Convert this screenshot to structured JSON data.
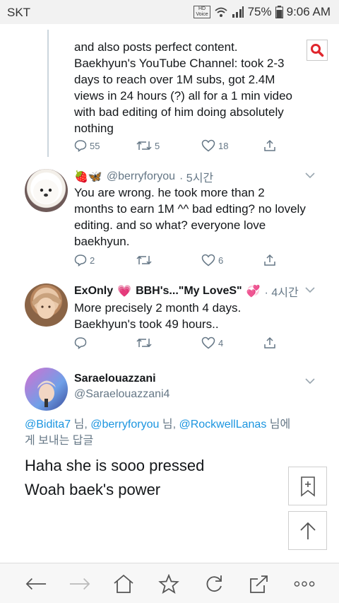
{
  "status_bar": {
    "carrier": "SKT",
    "hd_label": "HD",
    "voice_label": "Voice",
    "battery": "75%",
    "time": "9:06 AM"
  },
  "tweets": [
    {
      "lines": [
        "and also posts perfect content.",
        "Baekhyun's YouTube Channel: took 2-3",
        "days to reach over 1M subs, got 2.4M",
        "views in 24 hours (?) all for a 1 min video",
        "with bad editing of him doing absolutely",
        "nothing"
      ],
      "replies": "55",
      "retweets": "5",
      "likes": "18"
    },
    {
      "emoji": "🍓🦋",
      "handle": "@berryforyou",
      "time": "· 5시간",
      "lines": [
        "You are wrong. he took more than 2",
        "months to earn 1M ^^ bad edting? no lovely",
        "editing. and so what? everyone love",
        "baekhyun."
      ],
      "replies": "2",
      "retweets": "",
      "likes": "6"
    },
    {
      "name_part1": "ExOnly",
      "name_part2": "BBH's...\"My LoveS\"",
      "time": "· 4시간",
      "lines": [
        "More precisely 2 month 4 days.",
        "Baekhyun's took 49 hours.."
      ],
      "replies": "",
      "retweets": "",
      "likes": "4"
    }
  ],
  "focused": {
    "name": "Saraelouazzani",
    "handle": "@Saraelouazzani4",
    "reply_mentions": [
      "@Bidita7",
      "@berryforyou",
      "@RockwellLanas"
    ],
    "reply_suffix_1": " 님, ",
    "reply_suffix_2": " 님, ",
    "reply_suffix_3": " 님에",
    "reply_line2": "게 보내는 답글",
    "text_lines": [
      "Haha she is sooo pressed",
      "Woah baek's power"
    ]
  },
  "colors": {
    "link": "#1b95e0",
    "gray": "#657786",
    "search_red": "#e0262d"
  }
}
